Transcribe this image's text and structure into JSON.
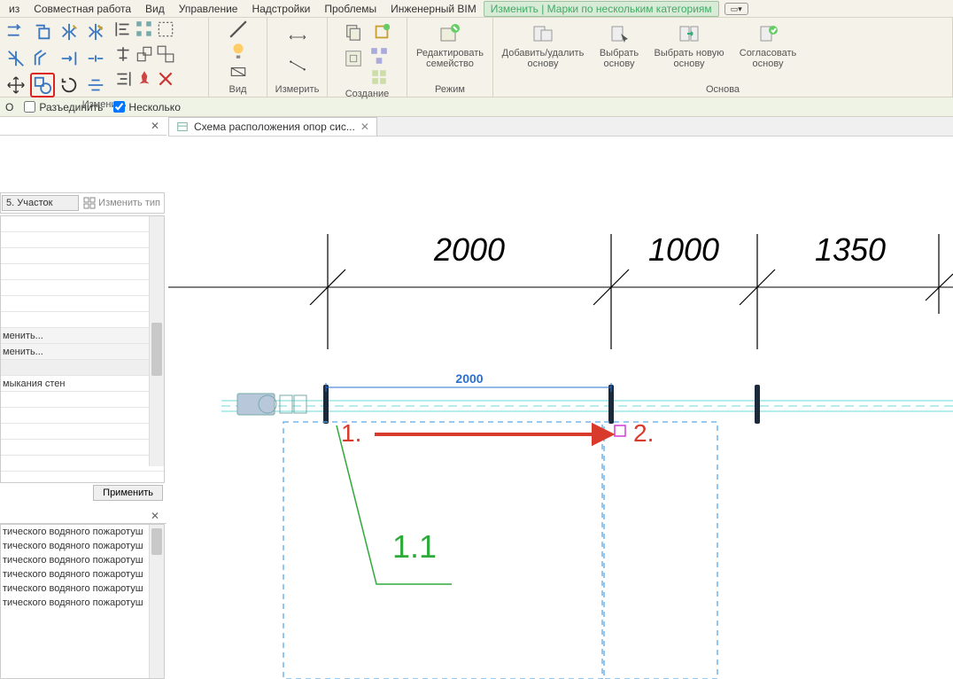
{
  "menu": {
    "items": [
      "из",
      "Совместная работа",
      "Вид",
      "Управление",
      "Надстройки",
      "Проблемы",
      "Инженерный BIM"
    ],
    "active_tab": "Изменить | Марки по нескольким категориям"
  },
  "ribbon": {
    "groups": {
      "modify": "Изменить",
      "view": "Вид",
      "measure": "Измерить",
      "create": "Создание",
      "mode": "Режим",
      "host": "Основа"
    },
    "big_buttons": {
      "edit_family": "Редактировать семейство",
      "add_remove_host": "Добавить/удалить основу",
      "pick_host": "Выбрать основу",
      "pick_new_host": "Выбрать новую основу",
      "reconcile_host": "Согласовать основу"
    }
  },
  "options": {
    "o_label": "О",
    "disjoin": "Разъединить",
    "multiple": "Несколько",
    "multiple_checked": true
  },
  "properties": {
    "type_combo": "5.  Участок",
    "edit_type": "Изменить тип",
    "rows_top_blank_count": 7,
    "link_rows": [
      "менить...",
      "менить..."
    ],
    "text_rows": [
      "мыкания стен",
      ""
    ],
    "apply": "Применить"
  },
  "browser": {
    "items": [
      "тического водяного пожаротуш",
      "тического водяного пожаротуш",
      "тического водяного пожаротуш",
      "тического водяного пожаротуш",
      "тического водяного пожаротуш",
      "тического водяного пожаротуш"
    ]
  },
  "doc_tab": {
    "title": "Схема расположения опор сис..."
  },
  "drawing": {
    "grid_dims": [
      "2000",
      "1000",
      "1350"
    ],
    "dim_label": "2000",
    "ann1": "1.",
    "ann2": "2.",
    "tag_text": "1.1"
  }
}
